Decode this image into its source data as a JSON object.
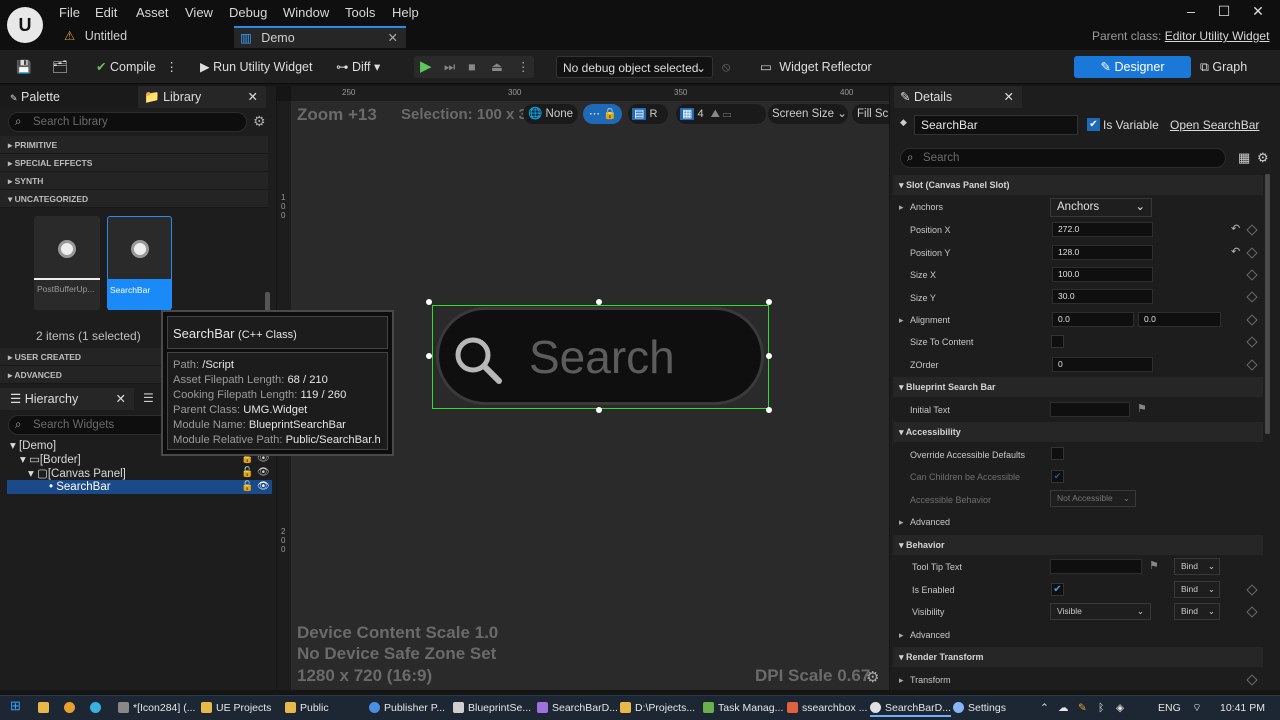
{
  "menu": [
    "File",
    "Edit",
    "Asset",
    "View",
    "Debug",
    "Window",
    "Tools",
    "Help"
  ],
  "tabs": [
    {
      "label": "Untitled"
    },
    {
      "label": "Demo"
    }
  ],
  "parent_class": {
    "label": "Parent class:",
    "value": "Editor Utility Widget"
  },
  "toolbar": {
    "compile": "Compile",
    "run": "Run Utility Widget",
    "diff": "Diff",
    "debug_select": "No debug object selected",
    "reflector": "Widget Reflector",
    "designer": "Designer",
    "graph": "Graph"
  },
  "palette": {
    "tab_palette": "Palette",
    "tab_library": "Library",
    "search_placeholder": "Search Library",
    "sections": [
      "PRIMITIVE",
      "SPECIAL EFFECTS",
      "SYNTH",
      "UNCATEGORIZED",
      "USER CREATED",
      "ADVANCED"
    ],
    "items": [
      {
        "label": "PostBufferUp..."
      },
      {
        "label": "SearchBar"
      }
    ],
    "count": "2 items (1 selected)"
  },
  "hierarchy": {
    "title": "Hierarchy",
    "search_placeholder": "Search Widgets",
    "nodes": [
      "[Demo]",
      "[Border]",
      "[Canvas Panel]",
      "SearchBar"
    ]
  },
  "tooltip": {
    "name": "SearchBar",
    "kind": "(C++ Class)",
    "lines": [
      {
        "k": "Path:",
        "v": "/Script"
      },
      {
        "k": "Asset Filepath Length:",
        "v": "68 / 210"
      },
      {
        "k": "Cooking Filepath Length:",
        "v": "119 / 260"
      },
      {
        "k": "Parent Class:",
        "v": "UMG.Widget"
      },
      {
        "k": "Module Name:",
        "v": "BlueprintSearchBar"
      },
      {
        "k": "Module Relative Path:",
        "v": "Public/SearchBar.h"
      }
    ]
  },
  "canvas": {
    "zoom": "Zoom +13",
    "selection": "Selection: 100 x 30",
    "none": "None",
    "r": "R",
    "grid": "4",
    "screen_size": "Screen Size",
    "fill": "Fill Scr",
    "ruler": [
      "250",
      "300",
      "350",
      "400"
    ],
    "ruler_v": [
      "100",
      "200"
    ],
    "widget_text": "Search",
    "device_scale": "Device Content Scale 1.0",
    "safe_zone": "No Device Safe Zone Set",
    "resolution": "1280 x 720 (16:9)",
    "dpi": "DPI Scale 0.67"
  },
  "details": {
    "title": "Details",
    "name": "SearchBar",
    "is_variable": "Is Variable",
    "open": "Open SearchBar",
    "search_placeholder": "Search",
    "slot_section": "Slot (Canvas Panel Slot)",
    "anchors_label": "Anchors",
    "anchors_value": "Anchors",
    "pos_x_label": "Position X",
    "pos_x": "272.0",
    "pos_y_label": "Position Y",
    "pos_y": "128.0",
    "size_x_label": "Size X",
    "size_x": "100.0",
    "size_y_label": "Size Y",
    "size_y": "30.0",
    "align_label": "Alignment",
    "align_x": "0.0",
    "align_y": "0.0",
    "size_to_content": "Size To Content",
    "zorder_label": "ZOrder",
    "zorder": "0",
    "bp_section": "Blueprint Search Bar",
    "initial_text": "Initial Text",
    "acc_section": "Accessibility",
    "override_acc": "Override Accessible Defaults",
    "children_acc": "Can Children be Accessible",
    "acc_behavior": "Accessible Behavior",
    "not_accessible": "Not Accessible",
    "advanced": "Advanced",
    "beh_section": "Behavior",
    "tooltip_text": "Tool Tip Text",
    "bind": "Bind",
    "is_enabled": "Is Enabled",
    "visibility": "Visibility",
    "visible": "Visible",
    "render_section": "Render Transform",
    "transform": "Transform"
  },
  "taskbar": [
    {
      "label": "*[Icon284] (...",
      "color": "#888"
    },
    {
      "label": "UE Projects",
      "color": "#e8b84a"
    },
    {
      "label": "Public",
      "color": "#e8b84a"
    },
    {
      "label": "Publisher P...",
      "color": "#4a90e2"
    },
    {
      "label": "BlueprintSe...",
      "color": "#cfcfcf"
    },
    {
      "label": "SearchBarD...",
      "color": "#a070e0"
    },
    {
      "label": "D:\\Projects...",
      "color": "#e8b84a"
    },
    {
      "label": "Task Manag...",
      "color": "#6ab04c"
    },
    {
      "label": "ssearchbox ...",
      "color": "#e06040"
    },
    {
      "label": "SearchBarD...",
      "color": "#e0e0e0"
    },
    {
      "label": "Settings",
      "color": "#8ab4f8"
    }
  ],
  "tray": {
    "lang": "ENG",
    "time": "10:41 PM"
  }
}
